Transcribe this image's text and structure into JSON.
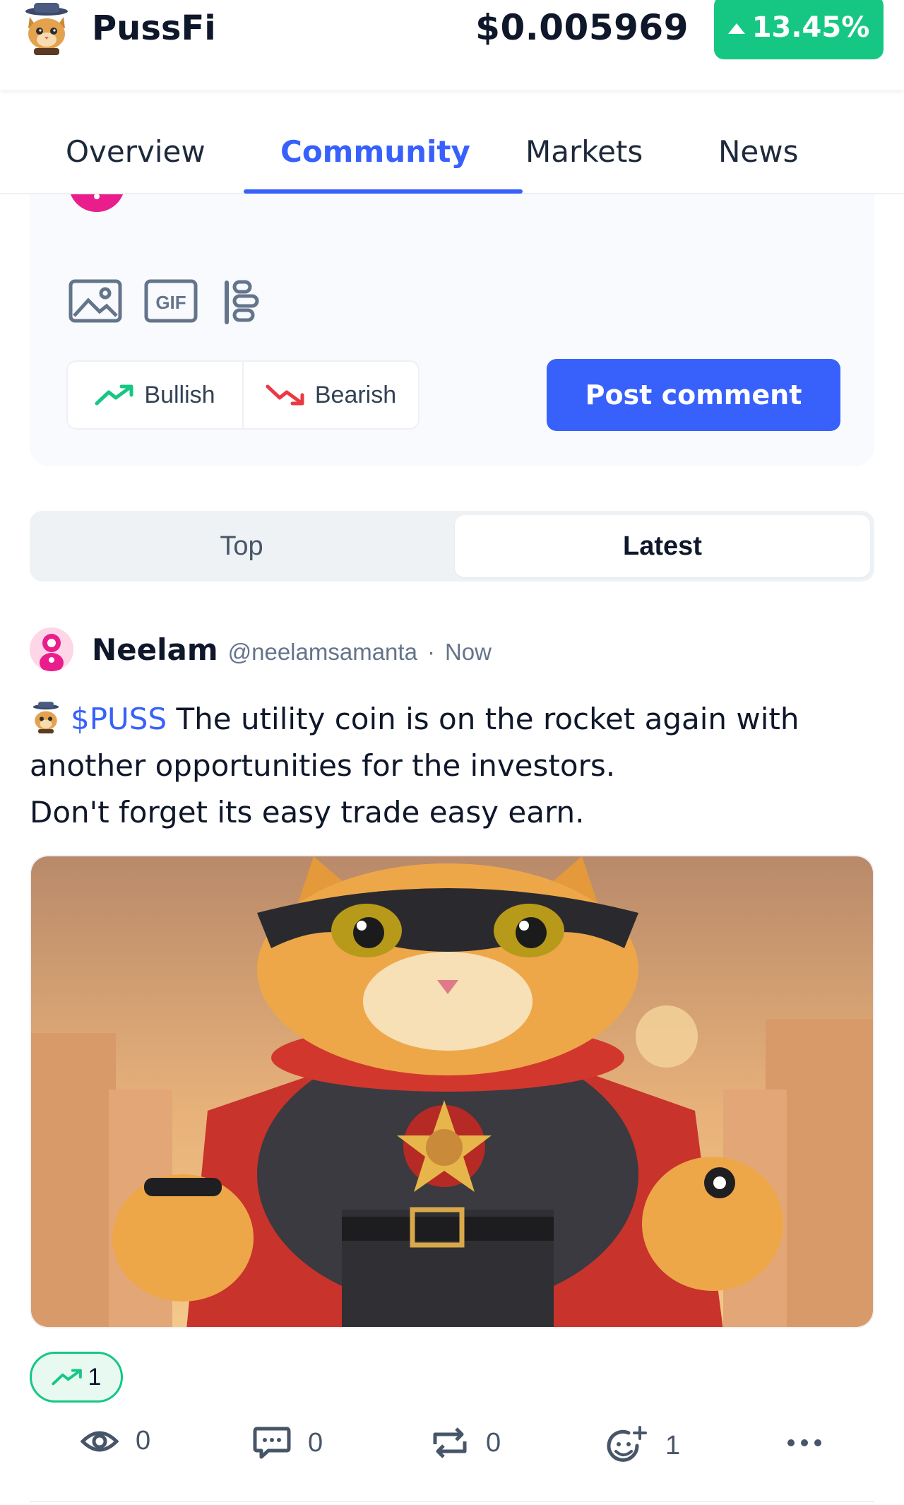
{
  "header": {
    "brand": "PussFi",
    "price": "$0.005969",
    "change": "13.45%",
    "change_color": "#16c784"
  },
  "tabs": [
    {
      "label": "Overview",
      "active": false
    },
    {
      "label": "Community",
      "active": true
    },
    {
      "label": "Markets",
      "active": false
    },
    {
      "label": "News",
      "active": false
    }
  ],
  "composer": {
    "tools": [
      "image-icon",
      "gif-icon",
      "poll-icon"
    ],
    "bullish_label": "Bullish",
    "bearish_label": "Bearish",
    "post_label": "Post comment"
  },
  "sort": {
    "top_label": "Top",
    "latest_label": "Latest",
    "selected": "Latest"
  },
  "post": {
    "author": "Neelam",
    "handle": "@neelamsamanta",
    "time": "Now",
    "cashtag": "$PUSS",
    "text_1": " The utility coin is on the rocket again with another opportunities for the investors.",
    "text_2": "Don't forget its easy trade easy earn.",
    "sentiment_count": "1",
    "stats": {
      "views": "0",
      "comments": "0",
      "reposts": "0",
      "reactions": "1"
    }
  },
  "colors": {
    "accent": "#3861fb",
    "bullish": "#16c784",
    "bearish": "#ea3943"
  }
}
